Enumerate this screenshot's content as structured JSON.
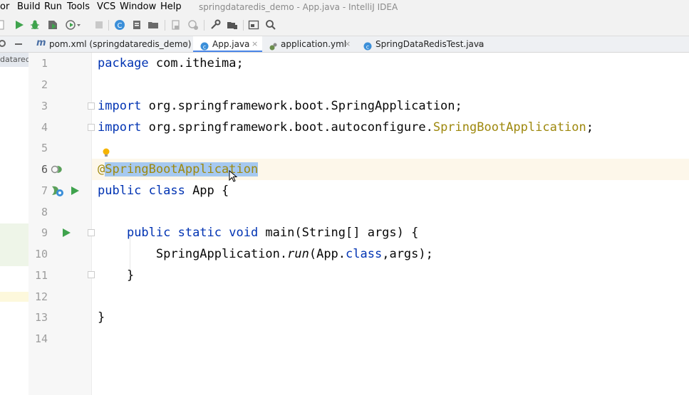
{
  "menu": {
    "items": [
      "or",
      "Build",
      "Run",
      "Tools",
      "VCS",
      "Window",
      "Help"
    ],
    "title": "springdataredis_demo - App.java - IntelliJ IDEA"
  },
  "toolbar": {
    "icons": [
      "dropdown-icon",
      "run-icon",
      "debug-icon",
      "coverage-icon",
      "profile-icon",
      "stop-icon",
      "build-icon",
      "file-icon",
      "folder-icon",
      "vcs-icon",
      "settings-icon",
      "wrench-icon",
      "structure-icon",
      "terminal-icon",
      "search-icon"
    ]
  },
  "tabs": [
    {
      "label": "pom.xml (springdataredis_demo)",
      "icon": "maven-icon",
      "active": false
    },
    {
      "label": "App.java",
      "icon": "java-class-icon",
      "active": true
    },
    {
      "label": "application.yml",
      "icon": "yaml-icon",
      "active": false
    },
    {
      "label": "SpringDataRedisTest.java",
      "icon": "java-class-icon",
      "active": false
    }
  ],
  "tab_close": "×",
  "project_panel": {
    "crumb": "dataredi"
  },
  "editor": {
    "line_numbers": [
      "1",
      "2",
      "3",
      "4",
      "5",
      "6",
      "7",
      "8",
      "9",
      "10",
      "11",
      "12",
      "13",
      "14"
    ],
    "current_line": "6",
    "lines": {
      "l1": {
        "kw": "package",
        "rest": " com.itheima;"
      },
      "l3": {
        "kw": "import",
        "rest": " org.springframework.boot.SpringApplication;"
      },
      "l4": {
        "kw": "import",
        "rest": " org.springframework.boot.autoconfigure.",
        "ann": "SpringBootApplication",
        "end": ";"
      },
      "l6": {
        "at": "@",
        "sel": "SpringBootApplication"
      },
      "l7": {
        "kw": "public class",
        "rest": " App {"
      },
      "l9": {
        "kw": "public static void",
        "rest": " main(String[] args) {"
      },
      "l10": {
        "pre": "SpringApplication.",
        "method": "run",
        "mid": "(App.",
        "kw": "class",
        "end": ",args);"
      },
      "l11": {
        "text": "}"
      },
      "l13": {
        "text": "}"
      }
    }
  },
  "colors": {
    "keyword": "#0033b3",
    "annotation": "#9e880d",
    "selection": "#a6c9f0",
    "run": "#3fa34d"
  }
}
